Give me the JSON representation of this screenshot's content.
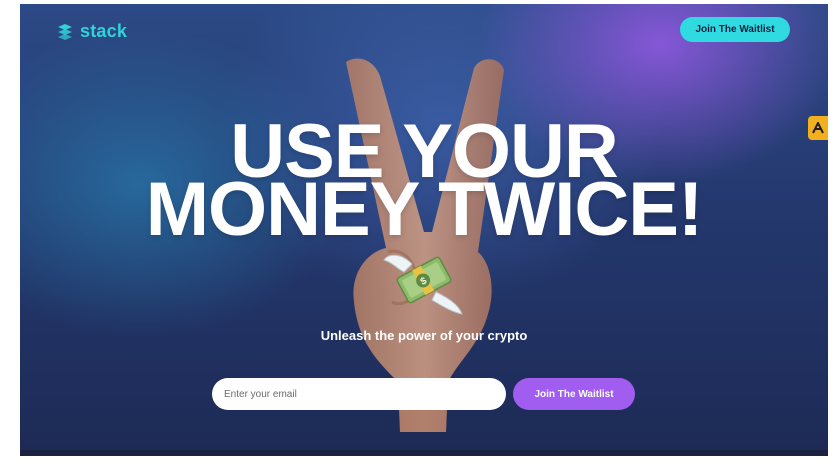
{
  "brand": {
    "name": "stack",
    "icon": "stack-logo-icon",
    "color": "#2fd3d9"
  },
  "header": {
    "cta_label": "Join The Waitlist"
  },
  "hero": {
    "headline_line1": "USE YOUR",
    "headline_line2": "MONEY TWICE!",
    "tagline": "Unleash the power of your crypto",
    "image": "peace-hand-with-flying-money",
    "money_icon": "money-with-wings-icon"
  },
  "form": {
    "email_placeholder": "Enter your email",
    "submit_label": "Join The Waitlist"
  },
  "widget": {
    "icon": "extension-a-icon"
  },
  "colors": {
    "accent_cyan": "#2fdbe0",
    "accent_purple": "#a15cf0",
    "background_navy": "#24386e"
  }
}
